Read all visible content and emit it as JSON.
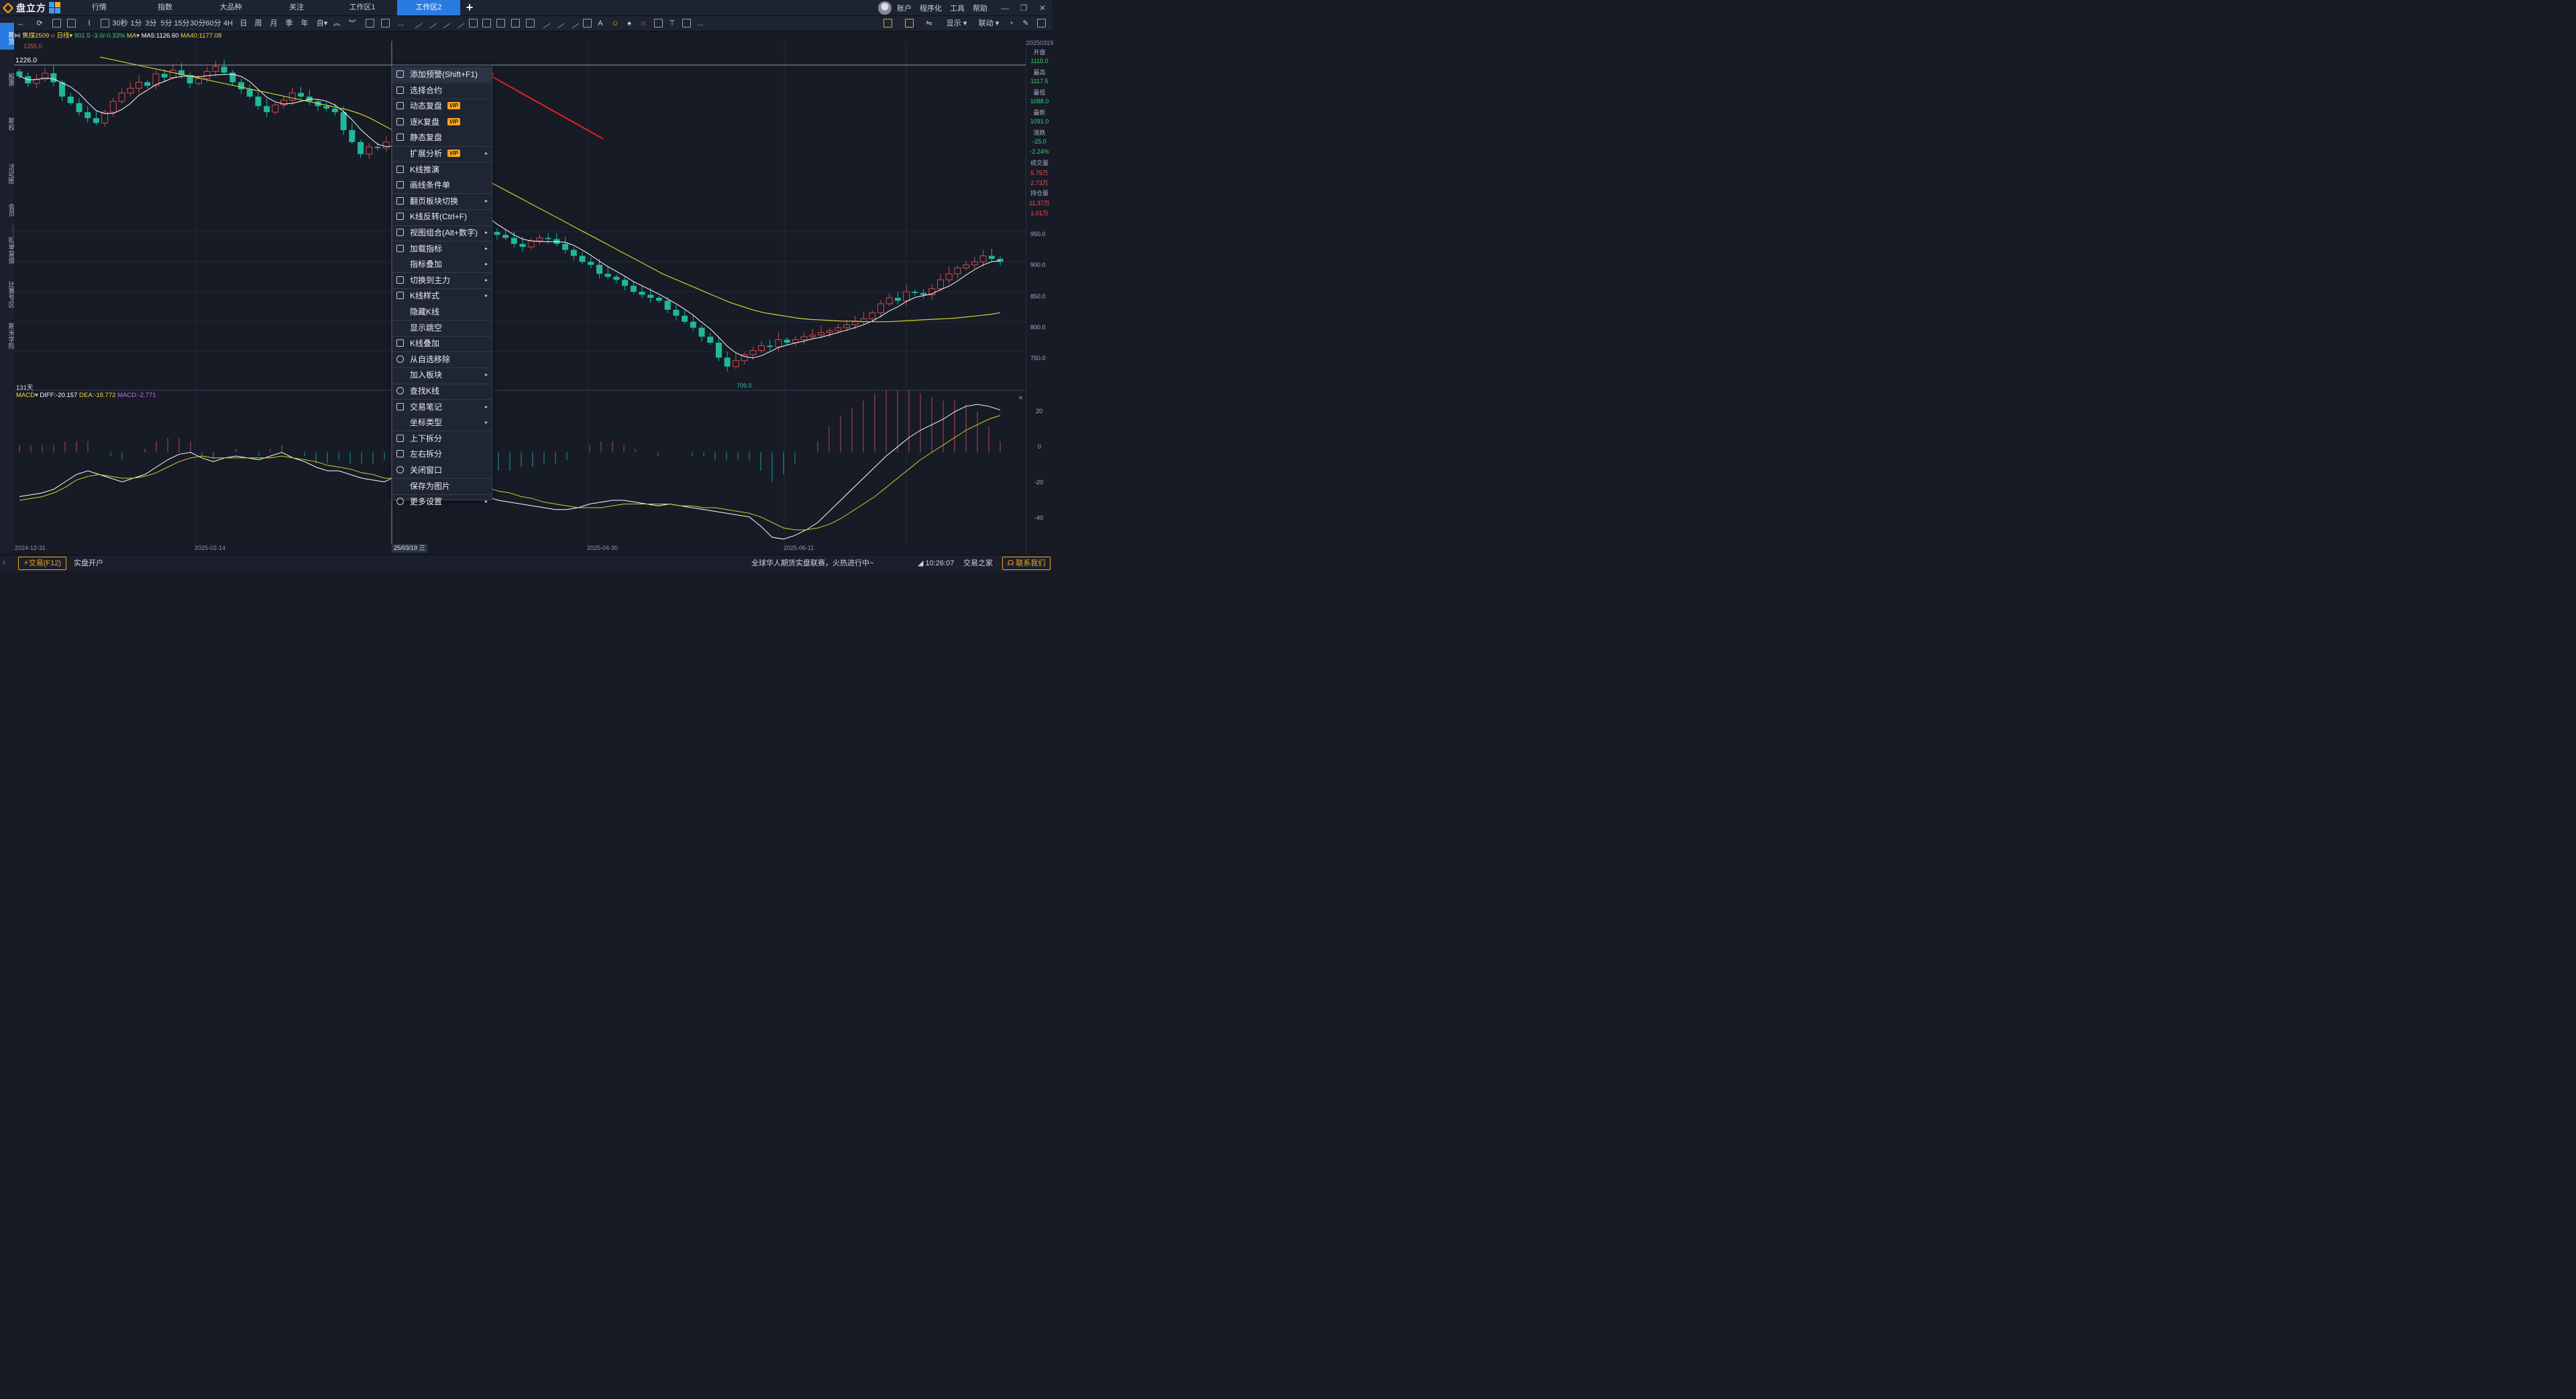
{
  "app": {
    "name": "盘立方"
  },
  "top_nav": [
    "行情",
    "指数",
    "大品种",
    "关注",
    "工作区1",
    "工作区2"
  ],
  "top_nav_active": "工作区2",
  "top_right": [
    "账户",
    "程序化",
    "工具",
    "帮助"
  ],
  "toolbar": {
    "periods": [
      "30秒",
      "1分",
      "3分",
      "5分",
      "15分",
      "30分",
      "60分",
      "4H",
      "日",
      "周",
      "月",
      "季",
      "年",
      "自"
    ],
    "more": "...",
    "right": [
      "显示",
      "联动"
    ]
  },
  "sidebar": [
    "期货",
    "股票",
    "期权",
    "活动圈",
    "会员",
    "账单复盘",
    "比赛专区",
    "期米学院"
  ],
  "chart_header": {
    "symbol": "焦煤2509",
    "period": "日线",
    "price": "901.5",
    "change": "-3.0/-0.33%",
    "ma_label": "MA",
    "ma5": "MA5:1126.60",
    "ma40": "MA40:1177.08"
  },
  "annotations": {
    "high": "1255.0",
    "low": "709.0",
    "cursor_value": "1226.0",
    "days": "131天"
  },
  "macd_header": {
    "name": "MACD",
    "diff": "DIFF:-20.157",
    "dea": "DEA:-18.772",
    "macd": "MACD:-2.771"
  },
  "x_dates": [
    "2024-12-31",
    "2025-02-14",
    "2025-04-30",
    "2025-06-11"
  ],
  "cursor_date": "25/03/19",
  "cursor_date_suffix": "三",
  "right_panel": {
    "date": "20250319",
    "items": [
      {
        "label": "开盘",
        "values": [
          "1115.0"
        ],
        "color": "#3dd16b"
      },
      {
        "label": "最高",
        "values": [
          "1117.5"
        ],
        "color": "#3dd16b"
      },
      {
        "label": "最低",
        "values": [
          "1088.0"
        ],
        "color": "#3dd16b"
      },
      {
        "label": "最新",
        "values": [
          "1091.0"
        ],
        "color": "#3dd16b"
      },
      {
        "label": "涨跌",
        "values": [
          "-25.0",
          "-2.24%"
        ],
        "color": "#3dd16b"
      },
      {
        "label": "成交量",
        "values": [
          "5.75万",
          "2.73万"
        ],
        "color": "#ff5050"
      },
      {
        "label": "持仓量",
        "values": [
          "11.37万",
          "1.01万"
        ],
        "color": "#ff5050"
      }
    ],
    "price_ticks": [
      "950.0",
      "900.0",
      "850.0",
      "800.0",
      "750.0"
    ],
    "macd_ticks": [
      "20",
      "0",
      "-20",
      "-40"
    ]
  },
  "context_menu": [
    {
      "label": "添加预警(Shift+F1)",
      "icon": "speaker-icon",
      "highlight": true
    },
    {
      "label": "选择合约",
      "icon": "select-icon"
    },
    {
      "label": "动态复盘",
      "icon": "replay-icon",
      "vip": "VIP"
    },
    {
      "label": "逐K复盘",
      "icon": "kline-replay-icon",
      "vip": "VIP"
    },
    {
      "label": "静态复盘",
      "icon": "static-replay-icon"
    },
    {
      "label": "扩展分析",
      "icon": "",
      "vip": "VIP",
      "sub": true
    },
    {
      "label": "K线推演",
      "icon": "deduce-icon"
    },
    {
      "label": "画线条件单",
      "icon": "draw-order-icon"
    },
    {
      "label": "翻页板块切换",
      "icon": "page-switch-icon",
      "sub": true
    },
    {
      "label": "K线反转(Ctrl+F)",
      "icon": "reverse-icon"
    },
    {
      "label": "视图组合(Alt+数字)",
      "icon": "view-combo-icon",
      "sub": true
    },
    {
      "label": "加载指标",
      "icon": "indicator-icon",
      "sub": true
    },
    {
      "label": "指标叠加",
      "icon": "",
      "sub": true
    },
    {
      "label": "切换到主力",
      "icon": "switch-main-icon",
      "sub": true
    },
    {
      "label": "K线样式",
      "icon": "kline-style-icon",
      "sub": true
    },
    {
      "label": "隐藏K线",
      "icon": ""
    },
    {
      "label": "显示跳空",
      "icon": ""
    },
    {
      "label": "K线叠加",
      "icon": "overlay-icon"
    },
    {
      "label": "从自选移除",
      "icon": "remove-icon"
    },
    {
      "label": "加入板块",
      "icon": "",
      "sub": true
    },
    {
      "label": "查找K线",
      "icon": "search-icon"
    },
    {
      "label": "交易笔记",
      "icon": "note-icon",
      "sub": true
    },
    {
      "label": "坐标类型",
      "icon": "",
      "sub": true
    },
    {
      "label": "上下拆分",
      "icon": "split-v-icon"
    },
    {
      "label": "左右拆分",
      "icon": "split-h-icon"
    },
    {
      "label": "关闭窗口",
      "icon": "close-icon"
    },
    {
      "label": "保存为图片",
      "icon": ""
    },
    {
      "label": "更多设置",
      "icon": "gear-icon",
      "sub": true
    }
  ],
  "status_bar": {
    "trade": "交易(F12)",
    "real_open": "实盘开户",
    "ticker": "全球华人期货实盘联赛，火热进行中~",
    "time": "10:26:07",
    "tz": "交易之家",
    "contact": "联系我们"
  },
  "chart_data": {
    "type": "candlestick",
    "symbol": "焦煤2509",
    "y_range": [
      700,
      1260
    ],
    "x_range": [
      "2024-12-31",
      "2025-06-30"
    ],
    "closes": [
      1210,
      1198,
      1205,
      1215,
      1200,
      1176,
      1165,
      1150,
      1140,
      1132,
      1150,
      1168,
      1182,
      1190,
      1200,
      1194,
      1214,
      1208,
      1220,
      1212,
      1198,
      1206,
      1218,
      1226,
      1216,
      1200,
      1188,
      1176,
      1160,
      1150,
      1162,
      1170,
      1182,
      1176,
      1168,
      1160,
      1156,
      1150,
      1120,
      1100,
      1080,
      1092,
      1090,
      1100,
      1106,
      1102,
      1091,
      1075,
      1060,
      1040,
      1010,
      1000,
      985,
      975,
      960,
      950,
      945,
      940,
      930,
      925,
      935,
      940,
      938,
      930,
      920,
      910,
      900,
      895,
      880,
      875,
      870,
      860,
      850,
      845,
      840,
      835,
      820,
      810,
      800,
      790,
      775,
      765,
      740,
      725,
      735,
      745,
      752,
      760,
      758,
      770,
      765,
      770,
      775,
      778,
      782,
      785,
      790,
      795,
      800,
      805,
      815,
      830,
      840,
      835,
      850,
      848,
      845,
      855,
      870,
      880,
      890,
      895,
      900,
      910,
      905,
      900
    ],
    "ma40": [
      1242,
      1238,
      1234,
      1230,
      1226,
      1222,
      1218,
      1214,
      1210,
      1206,
      1202,
      1198,
      1194,
      1190,
      1186,
      1182,
      1178,
      1174,
      1170,
      1166,
      1162,
      1158,
      1154,
      1148,
      1140,
      1130,
      1120,
      1110,
      1100,
      1090,
      1080,
      1070,
      1060,
      1050,
      1040,
      1030,
      1020,
      1010,
      1000,
      990,
      980,
      970,
      960,
      950,
      940,
      930,
      920,
      910,
      900,
      890,
      880,
      872,
      864,
      856,
      848,
      840,
      832,
      826,
      820,
      815,
      812,
      809,
      806,
      804,
      803,
      802,
      801,
      801,
      800,
      800,
      800,
      801,
      802,
      803,
      804,
      805,
      806,
      808,
      810,
      812,
      815
    ],
    "macd_diff": [
      -24,
      -23,
      -22,
      -20,
      -16,
      -12,
      -10,
      -12,
      -14,
      -16,
      -14,
      -12,
      -8,
      -4,
      -1,
      0,
      -3,
      -5,
      -3,
      -2,
      -3,
      -4,
      -2,
      0,
      -3,
      -5,
      -8,
      -10,
      -10,
      -12,
      -14,
      -15,
      -16,
      -13,
      -10,
      -8,
      -8,
      -12,
      -16,
      -20,
      -22,
      -24,
      -26,
      -27,
      -28,
      -29,
      -30,
      -31,
      -31,
      -30,
      -28,
      -27,
      -26,
      -26,
      -27,
      -28,
      -29,
      -28,
      -29,
      -30,
      -31,
      -32,
      -33,
      -34,
      -35,
      -40,
      -46,
      -47,
      -45,
      -42,
      -38,
      -32,
      -26,
      -20,
      -14,
      -8,
      -2,
      3,
      8,
      12,
      15,
      18,
      22,
      25,
      26,
      25,
      23
    ],
    "macd_dea": [
      -26,
      -25,
      -24,
      -22,
      -19,
      -15,
      -13,
      -12,
      -13,
      -14,
      -14,
      -13,
      -11,
      -8,
      -5,
      -3,
      -2,
      -3,
      -3,
      -3,
      -3,
      -3,
      -3,
      -2,
      -3,
      -4,
      -5,
      -7,
      -8,
      -9,
      -11,
      -12,
      -14,
      -14,
      -13,
      -12,
      -11,
      -12,
      -13,
      -15,
      -17,
      -19,
      -21,
      -22,
      -24,
      -25,
      -27,
      -28,
      -29,
      -30,
      -30,
      -30,
      -29,
      -28,
      -28,
      -28,
      -28,
      -28,
      -29,
      -29,
      -30,
      -30,
      -31,
      -32,
      -33,
      -35,
      -38,
      -41,
      -42,
      -42,
      -41,
      -39,
      -36,
      -32,
      -28,
      -24,
      -19,
      -14,
      -9,
      -4,
      0,
      4,
      8,
      12,
      15,
      18,
      20
    ]
  }
}
